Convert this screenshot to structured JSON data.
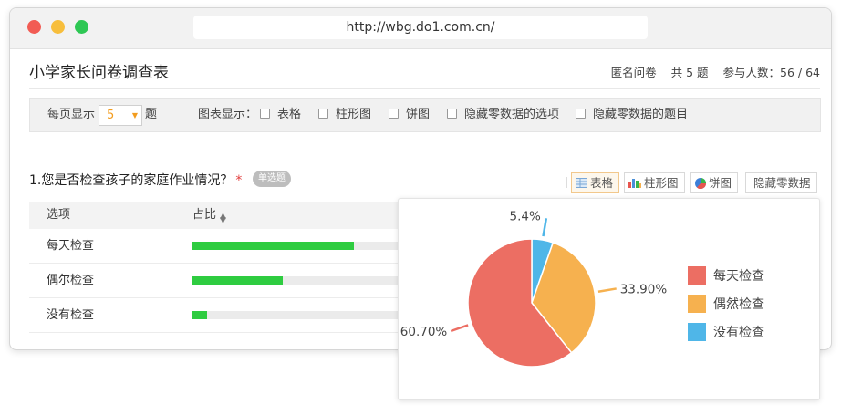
{
  "browser": {
    "url": "http://wbg.do1.com.cn/"
  },
  "header": {
    "title": "小学家长问卷调查表",
    "anonymous": "匿名问卷",
    "count_label": "共 5 题",
    "participants": "参与人数：56 / 64"
  },
  "filter": {
    "per_page_label": "每页显示",
    "per_page_value": "5",
    "per_page_suffix": "题",
    "chart_display_label": "图表显示：",
    "options": [
      "表格",
      "柱形图",
      "饼图",
      "隐藏零数据的选项",
      "隐藏零数据的题目"
    ]
  },
  "question": {
    "title": "1.您是否检查孩子的家庭作业情况？",
    "required_mark": "*",
    "badge": "单选题"
  },
  "view_buttons": [
    "表格",
    "柱形图",
    "饼图",
    "隐藏零数据"
  ],
  "table": {
    "col_option": "选项",
    "col_ratio": "占比",
    "rows": [
      {
        "label": "每天检查",
        "ratio": 0.607
      },
      {
        "label": "偶尔检查",
        "ratio": 0.339
      },
      {
        "label": "没有检查",
        "ratio": 0.054
      }
    ]
  },
  "chart_data": {
    "type": "pie",
    "slices": [
      {
        "name": "每天检查",
        "value": 60.7,
        "label": "60.70%",
        "color": "#ec6e63"
      },
      {
        "name": "偶然检查",
        "value": 33.9,
        "label": "33.90%",
        "color": "#f6b14f"
      },
      {
        "name": "没有检查",
        "value": 5.4,
        "label": "5.4%",
        "color": "#4fb6e8"
      }
    ],
    "legend_position": "right"
  },
  "colors": {
    "bar_fill": "#2ecc40",
    "accent_orange": "#f29c1f",
    "required_red": "#e23c3c"
  }
}
